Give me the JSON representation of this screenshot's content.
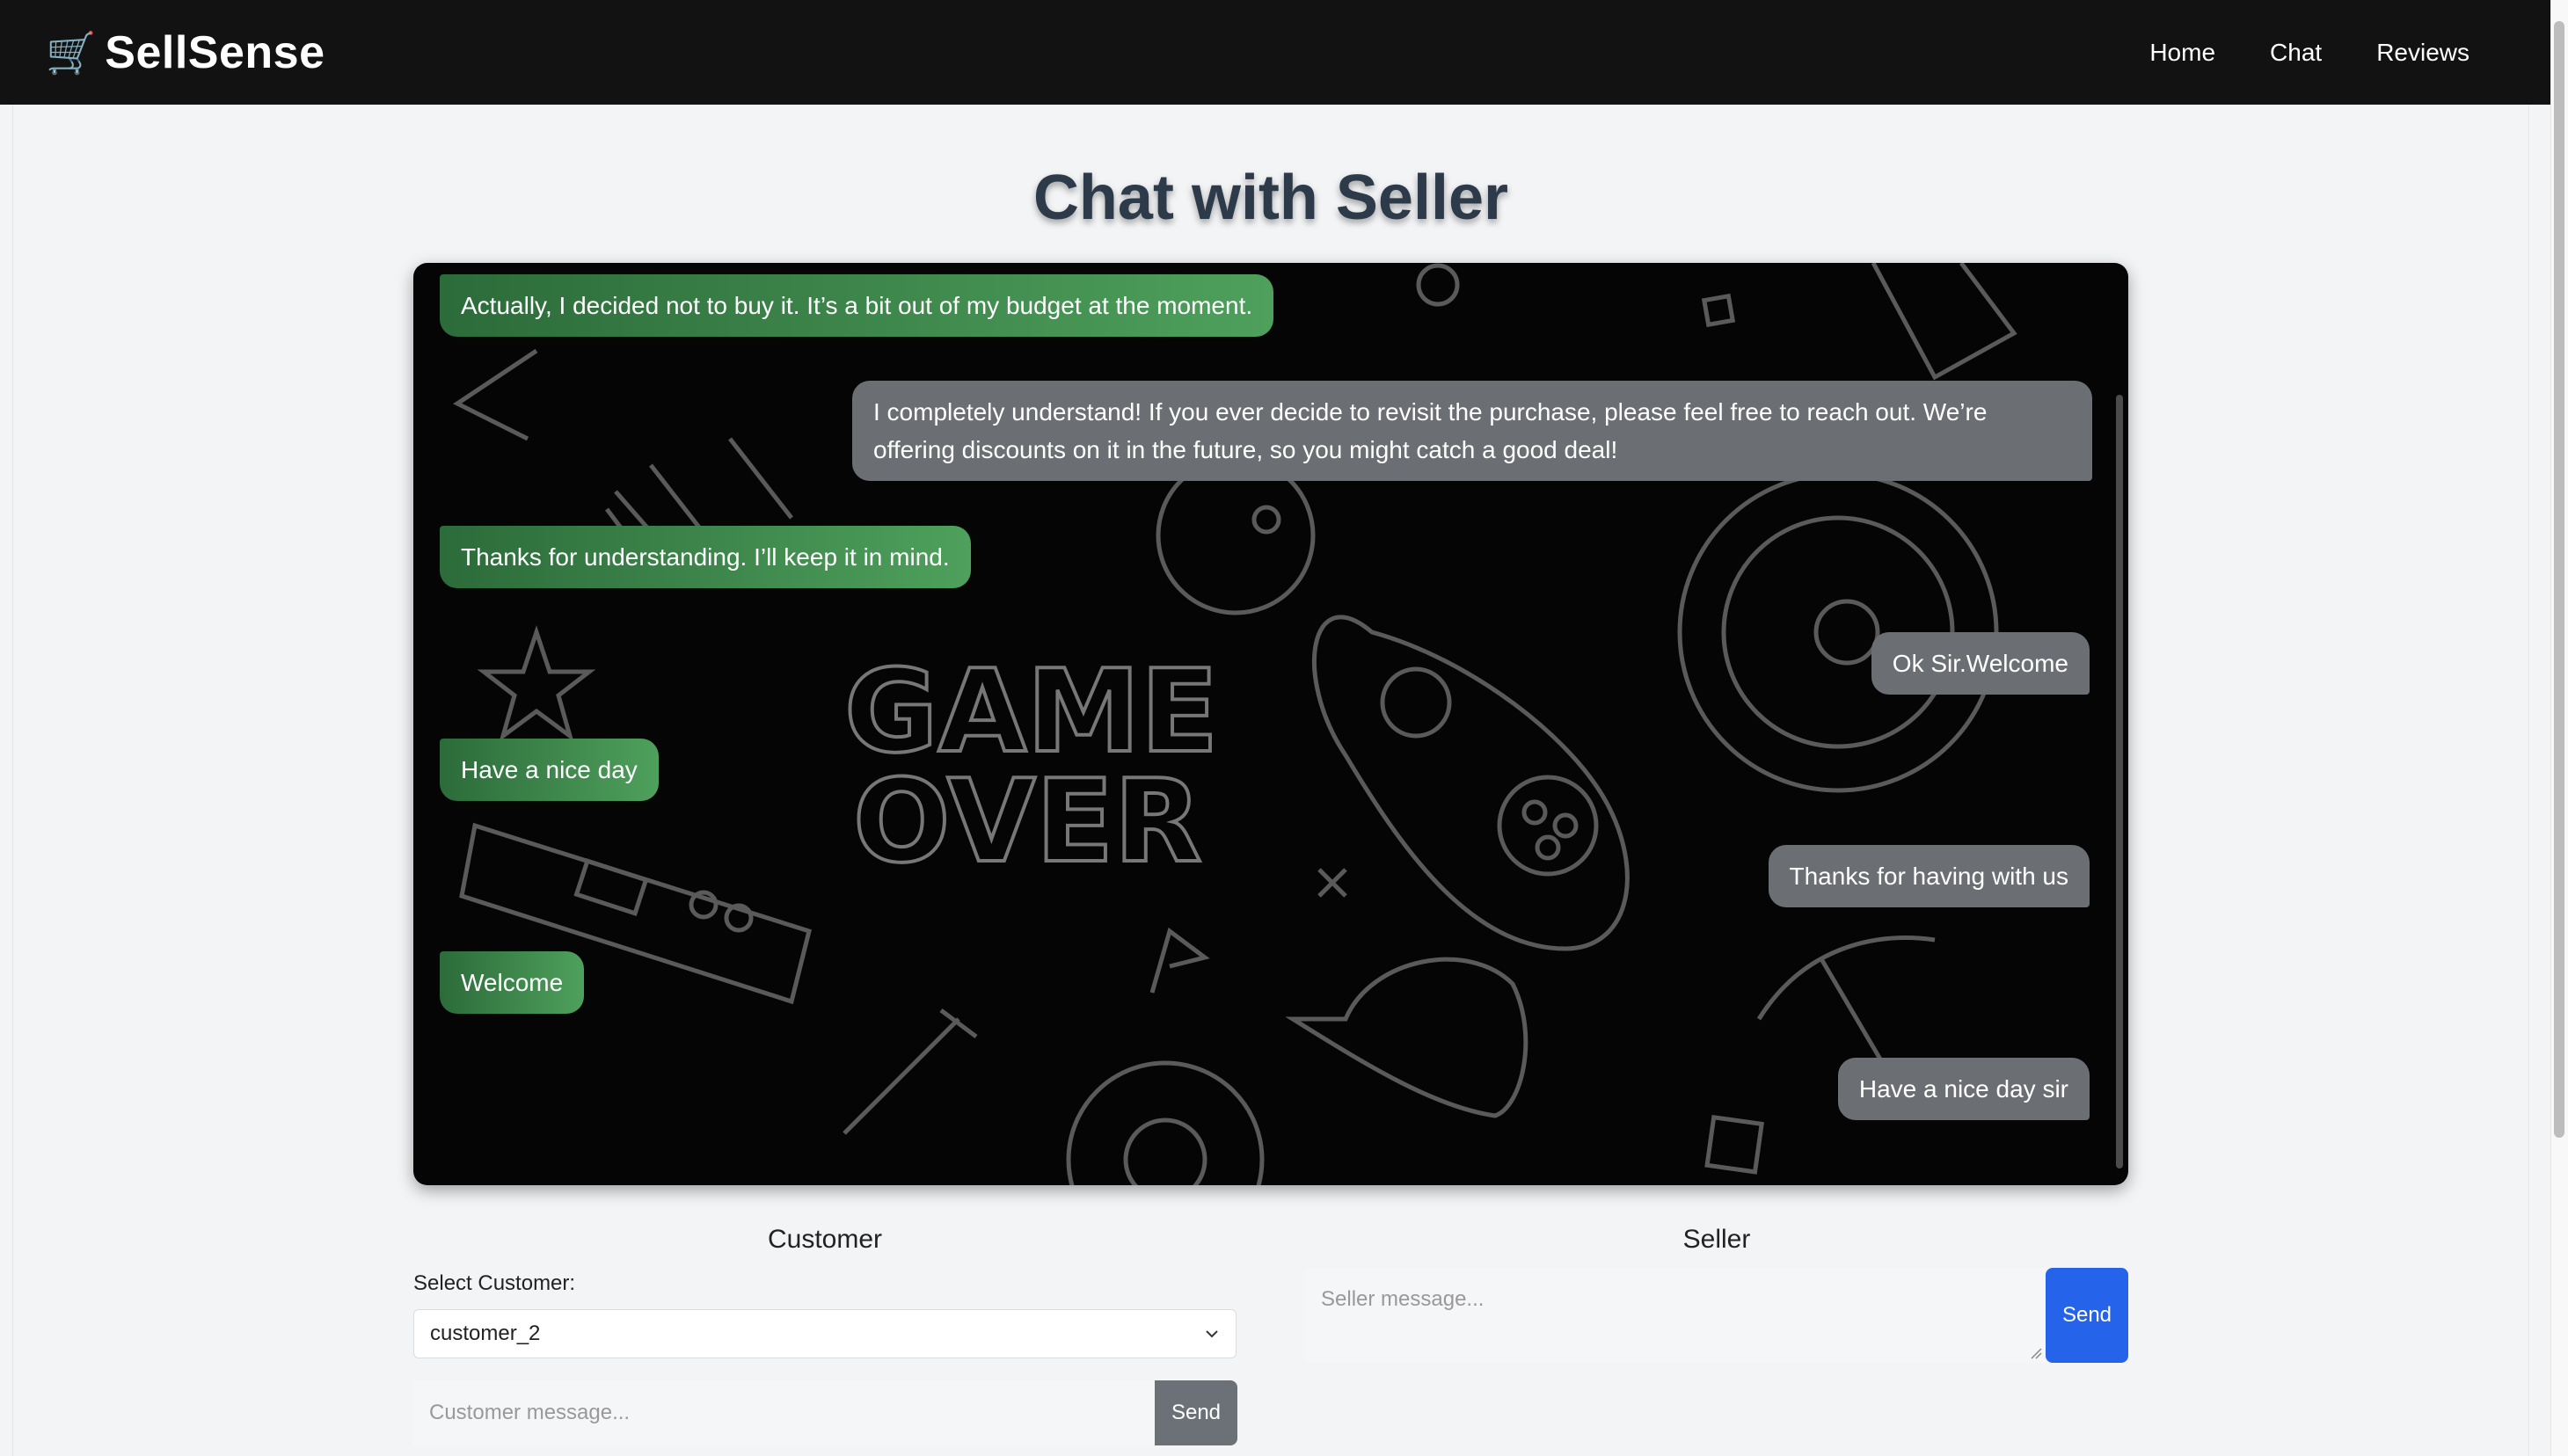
{
  "nav": {
    "brand_icon": "shopping-cart-icon",
    "brand_name": "SellSense",
    "links": [
      "Home",
      "Chat",
      "Reviews"
    ]
  },
  "page": {
    "title": "Chat with Seller"
  },
  "chat": {
    "background": "game-doodle-pattern",
    "messages": [
      {
        "sender": "customer",
        "text": "Actually, I decided not to buy it. It’s a bit out of my budget at the moment."
      },
      {
        "sender": "seller",
        "text": "I completely understand! If you ever decide to revisit the purchase, please feel free to reach out. We’re offering discounts on it in the future, so you might catch a good deal!"
      },
      {
        "sender": "customer",
        "text": "Thanks for understanding. I’ll keep it in mind."
      },
      {
        "sender": "seller",
        "text": "Ok Sir.Welcome"
      },
      {
        "sender": "customer",
        "text": "Have a nice day"
      },
      {
        "sender": "seller",
        "text": "Thanks for having with us"
      },
      {
        "sender": "customer",
        "text": "Welcome"
      },
      {
        "sender": "seller",
        "text": "Have a nice day sir"
      }
    ]
  },
  "customer_panel": {
    "title": "Customer",
    "select_label": "Select Customer:",
    "selected_customer": "customer_2",
    "input_placeholder": "Customer message...",
    "send_label": "Send"
  },
  "seller_panel": {
    "title": "Seller",
    "input_placeholder": "Seller message...",
    "send_label": "Send"
  },
  "colors": {
    "navbar": "#121212",
    "customer_bubble": "#4ea05c",
    "seller_bubble": "#6b6e72",
    "seller_send": "#2563eb",
    "customer_send": "#6b7177"
  }
}
